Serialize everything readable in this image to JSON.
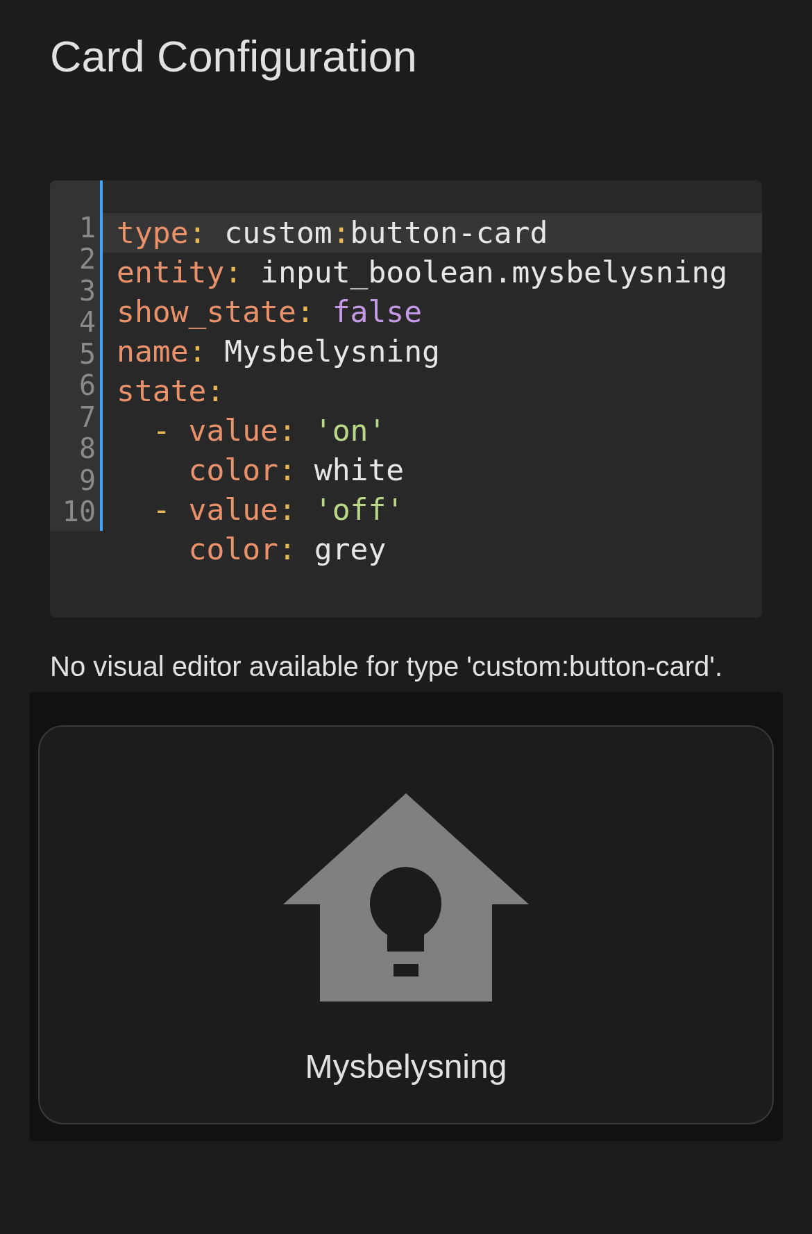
{
  "title": "Card Configuration",
  "editor": {
    "line_numbers": [
      "1",
      "2",
      "3",
      "4",
      "5",
      "6",
      "7",
      "8",
      "9",
      "10"
    ],
    "lines": [
      {
        "active": true,
        "tokens": [
          {
            "kind": "key",
            "text": "type"
          },
          {
            "kind": "punct",
            "text": ":"
          },
          {
            "kind": "plain",
            "text": " custom"
          },
          {
            "kind": "punct",
            "text": ":"
          },
          {
            "kind": "plain",
            "text": "button-card"
          }
        ]
      },
      {
        "active": false,
        "tokens": [
          {
            "kind": "key",
            "text": "entity"
          },
          {
            "kind": "punct",
            "text": ":"
          },
          {
            "kind": "plain",
            "text": " input_boolean.mysbelysning"
          }
        ]
      },
      {
        "active": false,
        "tokens": [
          {
            "kind": "key",
            "text": "show_state"
          },
          {
            "kind": "punct",
            "text": ":"
          },
          {
            "kind": "bool",
            "text": " false"
          }
        ]
      },
      {
        "active": false,
        "tokens": [
          {
            "kind": "key",
            "text": "name"
          },
          {
            "kind": "punct",
            "text": ":"
          },
          {
            "kind": "plain",
            "text": " Mysbelysning"
          }
        ]
      },
      {
        "active": false,
        "tokens": [
          {
            "kind": "key",
            "text": "state"
          },
          {
            "kind": "punct",
            "text": ":"
          }
        ]
      },
      {
        "active": false,
        "tokens": [
          {
            "kind": "punct",
            "text": "  -"
          },
          {
            "kind": "key",
            "text": " value"
          },
          {
            "kind": "punct",
            "text": ":"
          },
          {
            "kind": "string",
            "text": " 'on'"
          }
        ]
      },
      {
        "active": false,
        "tokens": [
          {
            "kind": "key",
            "text": "    color"
          },
          {
            "kind": "punct",
            "text": ":"
          },
          {
            "kind": "plain",
            "text": " white"
          }
        ]
      },
      {
        "active": false,
        "tokens": [
          {
            "kind": "punct",
            "text": "  -"
          },
          {
            "kind": "key",
            "text": " value"
          },
          {
            "kind": "punct",
            "text": ":"
          },
          {
            "kind": "string",
            "text": " 'off'"
          }
        ]
      },
      {
        "active": false,
        "tokens": [
          {
            "kind": "key",
            "text": "    color"
          },
          {
            "kind": "punct",
            "text": ":"
          },
          {
            "kind": "plain",
            "text": " grey"
          }
        ]
      }
    ]
  },
  "notice": "No visual editor available for type 'custom:button-card'.",
  "preview": {
    "name": "Mysbelysning",
    "on": false
  }
}
